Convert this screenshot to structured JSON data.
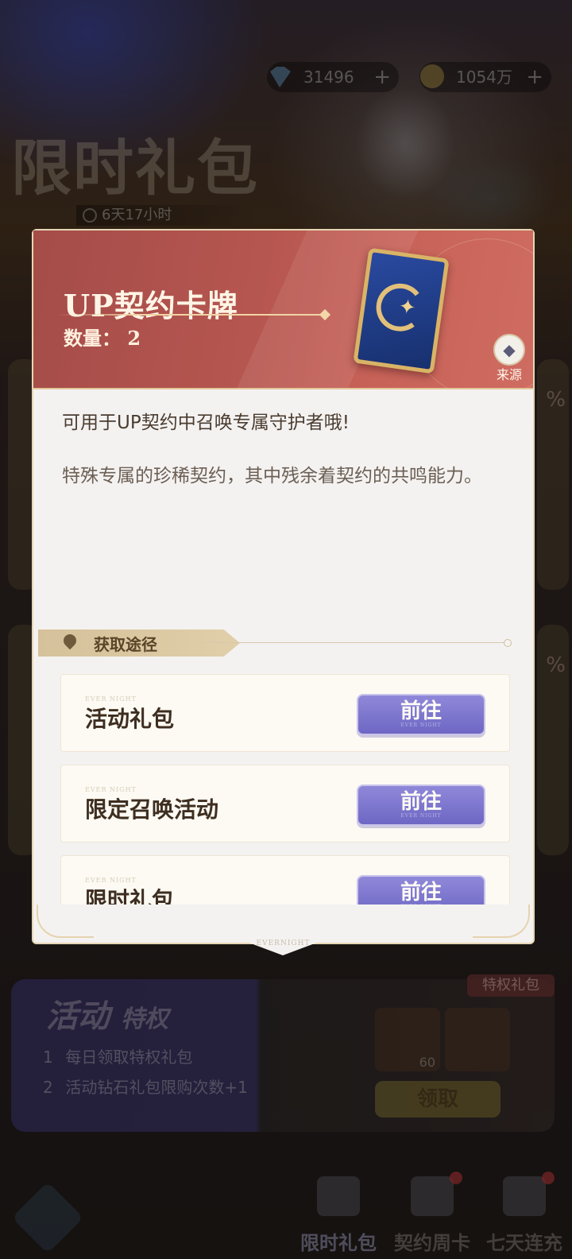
{
  "background": {
    "title": "限时礼包",
    "timer": "6天17小时",
    "currencies": [
      {
        "icon": "diamond-icon",
        "value": "31496"
      },
      {
        "icon": "gold-coin-icon",
        "value": "1054万"
      }
    ],
    "percent_badge": "%",
    "privilege": {
      "title_main": "活动",
      "title_sub": "特权",
      "tag": "特权礼包",
      "lines": [
        {
          "num": "1",
          "text": "每日领取特权礼包"
        },
        {
          "num": "2",
          "text": "活动钻石礼包限购次数+1"
        }
      ],
      "item_count": "60",
      "claim_label": "领取"
    },
    "tabs": [
      {
        "label": "限时礼包",
        "active": true
      },
      {
        "label": "契约周卡",
        "active": false
      },
      {
        "label": "七天连充",
        "active": false
      }
    ]
  },
  "modal": {
    "item_name": "UP契约卡牌",
    "quantity": "数量：  2",
    "source_label": "来源",
    "description": "可用于UP契约中召唤专属守护者哦!",
    "flavor": "特殊专属的珍稀契约，其中残余着契约的共鸣能力。",
    "acquire_title": "获取途径",
    "row_mark": "EVER NIGHT",
    "routes": [
      {
        "name": "活动礼包",
        "button": "前往"
      },
      {
        "name": "限定召唤活动",
        "button": "前往"
      },
      {
        "name": "限时礼包",
        "button": "前往"
      }
    ],
    "footer_mark": "EVERNIGHT",
    "accent": "#a54c49",
    "button_color": "#7c75cf"
  }
}
